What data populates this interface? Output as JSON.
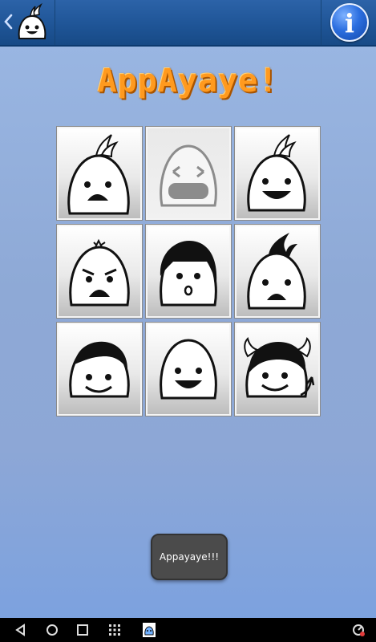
{
  "app": {
    "title": "AppAyaye!",
    "toast": "Appayaye!!!"
  },
  "topbar": {
    "back_icon": "back-chevron-icon",
    "app_icon": "ghost-avatar-icon",
    "info_label": "i"
  },
  "grid": {
    "faces": [
      "spiky-hair-scared-face",
      "sleepy-yawning-face",
      "spiky-hair-smiling-face",
      "angry-face",
      "girl-surprised-face",
      "mohawk-sad-face",
      "boy-smiling-face",
      "bald-smiling-face",
      "devil-girl-face"
    ],
    "pressed_index": 1
  },
  "navbar": {
    "buttons": [
      "back-icon",
      "home-icon",
      "recents-icon",
      "apps-grid-icon",
      "app-thumbnail-icon"
    ],
    "status": "status-indicator-icon"
  }
}
